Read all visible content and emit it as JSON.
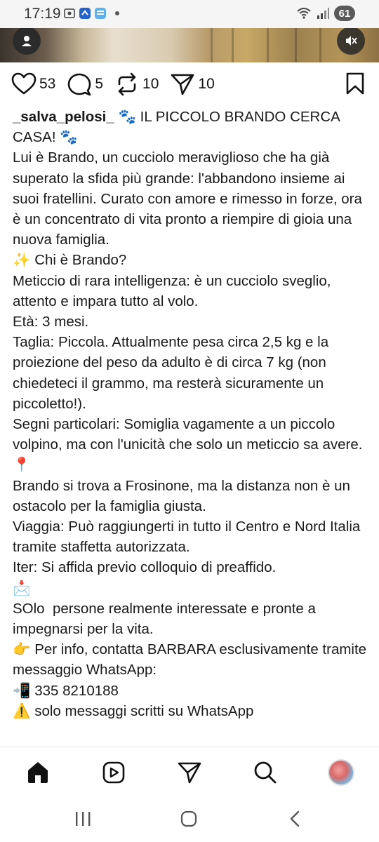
{
  "status_bar": {
    "time": "17:19",
    "battery": "61"
  },
  "post": {
    "likes": "53",
    "comments": "5",
    "reposts": "10",
    "shares": "10",
    "username": "_salva_pelosi_",
    "caption_lines": [
      " 🐾 IL PICCOLO BRANDO CERCA CASA! 🐾",
      "Lui è Brando, un cucciolo meraviglioso che ha già superato la sfida più grande: l'abbandono insieme ai suoi fratellini. Curato con amore e rimesso in forze, ora è un concentrato di vita pronto a riempire di gioia una nuova famiglia.",
      "✨ Chi è Brando?",
      "Meticcio di rara intelligenza: è un cucciolo sveglio, attento e impara tutto al volo.",
      "Età: 3 mesi.",
      "Taglia: Piccola. Attualmente pesa circa 2,5 kg e la proiezione del peso da adulto è di circa 7 kg (non chiedeteci il grammo, ma resterà sicuramente un piccoletto!).",
      "Segni particolari: Somiglia vagamente a un piccolo volpino, ma con l'unicità che solo un meticcio sa avere.",
      "📍",
      "Brando si trova a Frosinone, ma la distanza non è un ostacolo per la famiglia giusta.",
      "Viaggia: Può raggiungerti in tutto il Centro e Nord Italia tramite staffetta autorizzata.",
      "Iter: Si affida previo colloquio di preaffido.",
      "📩",
      "SOlo  persone realmente interessate e pronte a impegnarsi per la vita.",
      "👉 Per info, contatta BARBARA esclusivamente tramite messaggio WhatsApp:",
      "📲 335 8210188",
      "⚠️ solo messaggi scritti su WhatsApp"
    ]
  },
  "icons": {
    "like": "heart-icon",
    "comment": "comment-icon",
    "repost": "repost-icon",
    "share": "send-icon",
    "save": "bookmark-icon"
  }
}
